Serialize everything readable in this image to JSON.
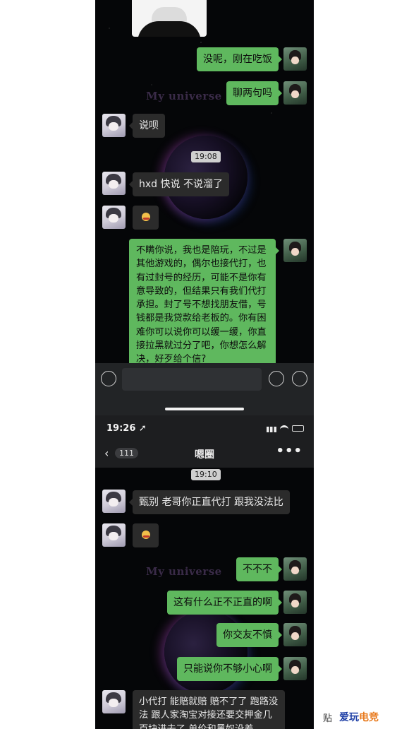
{
  "messages_top": [
    {
      "side": "right",
      "text": "没呢，刚在吃饭"
    },
    {
      "side": "right",
      "text": "聊两句吗"
    },
    {
      "side": "left",
      "text": "说呗"
    },
    {
      "side": "left",
      "text": "hxd 快说 不说溜了"
    },
    {
      "side": "left",
      "text": "👍"
    },
    {
      "side": "right",
      "text": "不瞒你说，我也是陪玩，不过是其他游戏的，偶尔也接代打，也有过封号的经历，可能不是你有意导致的，但结果只有我们代打承担。封了号不想找朋友借，号钱都是我贷款给老板的。你有困难你可以说你可以缓一缓，你直接拉黑就过分了吧，你想怎么解决，好歹给个信?"
    }
  ],
  "time_top": "19:08",
  "watermark": "My universe",
  "status": {
    "time": "19:26",
    "location_arrow": "➚"
  },
  "chat_header": {
    "back_symbol": "‹",
    "unread": "111",
    "title": "嗯圈",
    "more": "•••"
  },
  "time_bottom": "19:10",
  "messages_bottom": [
    {
      "side": "left",
      "text": "甄别 老哥你正直代打 跟我没法比"
    },
    {
      "side": "left",
      "text": "👍"
    },
    {
      "side": "right",
      "text": "不不不"
    },
    {
      "side": "right",
      "text": "这有什么正不正直的啊"
    },
    {
      "side": "right",
      "text": "你交友不慎"
    },
    {
      "side": "right",
      "text": "只能说你不够小心啊"
    },
    {
      "side": "left",
      "text": "小代打 能赔就赔 赔不了了 跑路没法 跟人家淘宝对接还要交押金几百块进去了 单价和黑奴没差"
    }
  ],
  "footer": {
    "paste": "贴",
    "brand_main": "爱玩",
    "brand_alt": "电竞"
  },
  "colors": {
    "bubble_right": "#5fb85e",
    "bubble_left": "#2b2b2b",
    "background": "#050608"
  }
}
